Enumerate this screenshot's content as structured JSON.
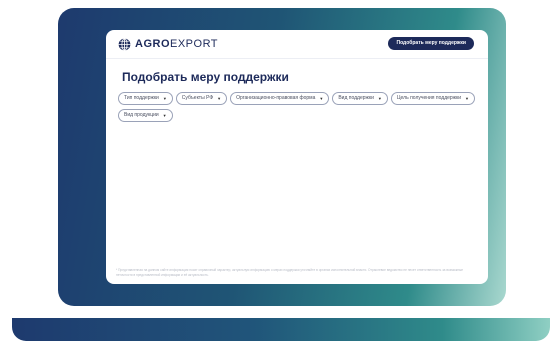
{
  "brand": {
    "logo_text_bold": "AGRO",
    "logo_text_light": "EXPORT",
    "navy": "#1d2a5a",
    "teal": "#2f8b8a"
  },
  "header": {
    "cta_label": "Подобрать меру поддержки"
  },
  "page": {
    "title": "Подобрать меру поддержки"
  },
  "filters": [
    {
      "label": "Тип поддержки",
      "icon": "caret-down-icon"
    },
    {
      "label": "Субъекты РФ",
      "icon": "caret-down-icon"
    },
    {
      "label": "Организационно-правовая форма",
      "icon": "caret-down-icon"
    },
    {
      "label": "Вид поддержки",
      "icon": "caret-down-icon"
    },
    {
      "label": "Цель получения поддержки",
      "icon": "caret-down-icon"
    },
    {
      "label": "Вид продукции",
      "icon": "caret-down-icon"
    }
  ],
  "footnote": "* Представленная на данном сайте информация носит справочный характер, актуальную информацию о мерах поддержки уточняйте в органах исполнительной власти. Отраслевое ведомство не несет ответственность за возможные неточности в представленной информации и её актуальность."
}
